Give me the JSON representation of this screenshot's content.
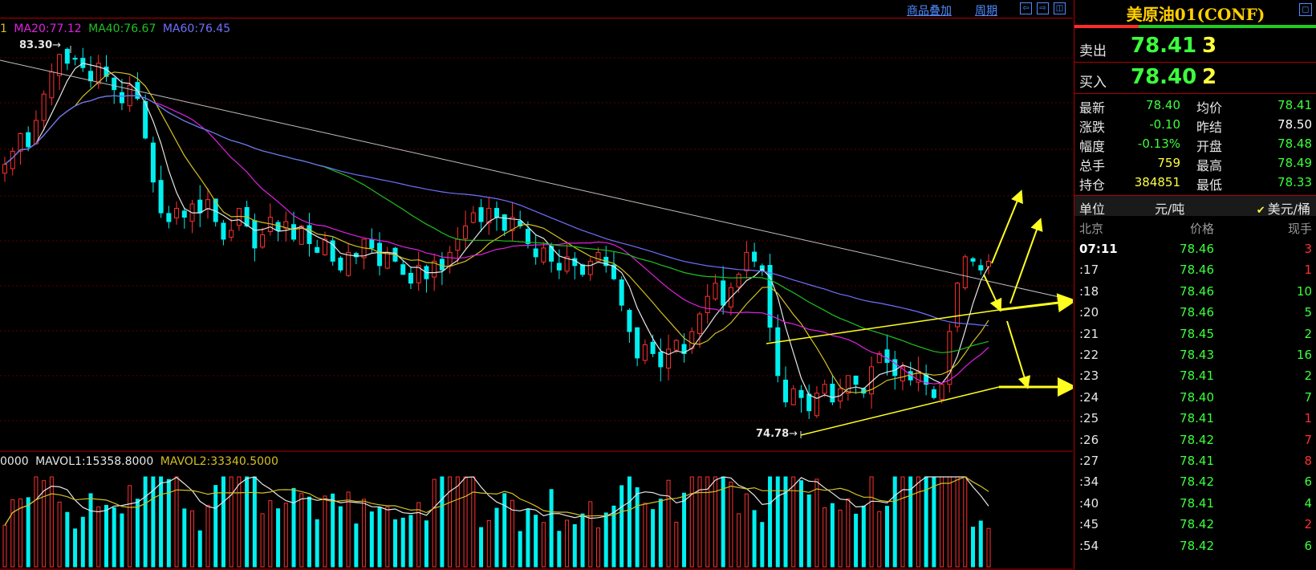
{
  "toolbar": {
    "overlay_label": "商品叠加",
    "period_label": "周期",
    "btn_left": "⇦",
    "btn_right": "⇨",
    "btn_split": "◫"
  },
  "ma_legend": {
    "ma10_partial": "1",
    "ma20": "MA20:77.12",
    "ma40": "MA40:76.67",
    "ma60": "MA60:76.45"
  },
  "vol_legend": {
    "vol_partial": "0000",
    "mavol1": "MAVOL1:15358.8000",
    "mavol2": "MAVOL2:33340.5000"
  },
  "annotations": {
    "high": "83.30",
    "low": "74.78"
  },
  "colors": {
    "up": "#ff3030",
    "down": "#00f0f0",
    "ma_fast": "#e6e6e6",
    "ma10": "#d4c020",
    "ma20": "#e020e0",
    "ma40": "#20c020",
    "ma60": "#7070ff",
    "trendline": "#c0c0c0",
    "arrow": "#ffff20"
  },
  "quote": {
    "title": "美原油01(CONF)",
    "window_btn": "◻",
    "bid_ask_ratio": 0.6,
    "sell_label": "卖出",
    "sell_price": "78.41",
    "sell_qty": "3",
    "buy_label": "买入",
    "buy_price": "78.40",
    "buy_qty": "2",
    "stats": [
      {
        "label": "最新",
        "value": "78.40",
        "label2": "均价",
        "value2": "78.41"
      },
      {
        "label": "涨跌",
        "value": "-0.10",
        "label2": "昨结",
        "value2": "78.50"
      },
      {
        "label": "幅度",
        "value": "-0.13%",
        "label2": "开盘",
        "value2": "78.48"
      },
      {
        "label": "总手",
        "value": "759",
        "label2": "最高",
        "value2": "78.49"
      },
      {
        "label": "持仓",
        "value": "384851",
        "label2": "最低",
        "value2": "78.33"
      }
    ],
    "unit_label": "单位",
    "unit_cny": "元/吨",
    "unit_usd": "美元/桶",
    "tick_headers": {
      "time": "北京",
      "price": "价格",
      "volume": "现手"
    },
    "ticks": [
      {
        "time": "07:11",
        "price": "78.46",
        "vol": "3",
        "dir": "up"
      },
      {
        "time": ":17",
        "price": "78.46",
        "vol": "1",
        "dir": "up"
      },
      {
        "time": ":18",
        "price": "78.46",
        "vol": "10",
        "dir": "flat"
      },
      {
        "time": ":20",
        "price": "78.46",
        "vol": "5",
        "dir": "flat"
      },
      {
        "time": ":21",
        "price": "78.45",
        "vol": "2",
        "dir": "flat"
      },
      {
        "time": ":22",
        "price": "78.43",
        "vol": "16",
        "dir": "flat"
      },
      {
        "time": ":23",
        "price": "78.41",
        "vol": "2",
        "dir": "flat"
      },
      {
        "time": ":24",
        "price": "78.40",
        "vol": "7",
        "dir": "flat"
      },
      {
        "time": ":25",
        "price": "78.41",
        "vol": "1",
        "dir": "up"
      },
      {
        "time": ":26",
        "price": "78.42",
        "vol": "7",
        "dir": "up"
      },
      {
        "time": ":27",
        "price": "78.41",
        "vol": "8",
        "dir": "up"
      },
      {
        "time": ":34",
        "price": "78.42",
        "vol": "6",
        "dir": "flat"
      },
      {
        "time": ":40",
        "price": "78.41",
        "vol": "4",
        "dir": "flat"
      },
      {
        "time": ":45",
        "price": "78.42",
        "vol": "2",
        "dir": "up"
      },
      {
        "time": ":54",
        "price": "78.42",
        "vol": "6",
        "dir": "flat"
      }
    ]
  },
  "chart_data": {
    "type": "candlestick",
    "price_range": [
      74.3,
      83.9
    ],
    "high_marker": 83.3,
    "low_marker": 74.78,
    "closes": [
      80.6,
      80.9,
      81.3,
      81.0,
      81.6,
      82.2,
      82.7,
      83.1,
      82.9,
      83.0,
      82.8,
      82.5,
      82.9,
      82.6,
      82.3,
      82.0,
      82.4,
      82.1,
      81.2,
      80.2,
      79.5,
      79.3,
      79.6,
      79.4,
      79.7,
      79.5,
      79.8,
      79.3,
      78.9,
      79.1,
      79.6,
      79.2,
      78.7,
      79.0,
      79.4,
      79.1,
      79.3,
      78.9,
      79.2,
      78.8,
      78.6,
      78.9,
      78.4,
      78.2,
      78.6,
      78.5,
      78.9,
      78.7,
      78.3,
      78.6,
      78.4,
      78.1,
      77.9,
      78.3,
      78.0,
      78.4,
      78.2,
      78.6,
      78.9,
      79.2,
      79.5,
      79.3,
      79.6,
      79.4,
      79.1,
      79.4,
      79.2,
      78.8,
      78.5,
      78.7,
      78.4,
      78.2,
      78.5,
      78.3,
      78.1,
      78.4,
      78.6,
      78.3,
      78.0,
      77.4,
      76.8,
      76.2,
      76.5,
      76.3,
      76.0,
      76.4,
      76.6,
      76.3,
      76.8,
      77.2,
      77.6,
      77.9,
      77.4,
      77.8,
      78.1,
      78.6,
      78.4,
      78.2,
      76.9,
      75.8,
      75.2,
      75.5,
      75.3,
      75.0,
      75.4,
      75.6,
      75.2,
      75.5,
      75.8,
      75.6,
      75.4,
      76.0,
      76.3,
      76.1,
      75.8,
      76.0,
      75.7,
      75.9,
      75.6,
      75.3,
      75.6,
      76.8,
      77.9,
      78.5,
      78.4,
      78.2,
      78.4
    ],
    "mavol1": 15358.8,
    "mavol2": 33340.5
  }
}
